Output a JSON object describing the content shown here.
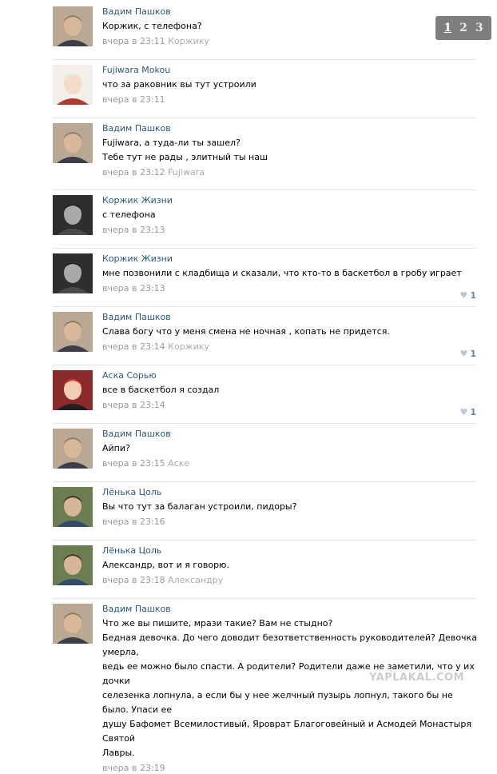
{
  "pager": {
    "pages": [
      "1",
      "2",
      "3"
    ],
    "current": "1"
  },
  "watermark": "YAPLAKAL.COM",
  "comments": [
    {
      "avatar": "putin",
      "author": "Вадим Пашков",
      "lines": [
        "Коржик, с телефона?"
      ],
      "time": "вчера в 23:11",
      "reply_to": "Коржику",
      "likes": ""
    },
    {
      "avatar": "anime-white",
      "author": "Fujiwara Mokou",
      "lines": [
        "что за раковник вы тут устроили"
      ],
      "time": "вчера в 23:11",
      "reply_to": "",
      "likes": ""
    },
    {
      "avatar": "putin",
      "author": "Вадим Пашков",
      "lines": [
        "Fujiwara, а туда-ли ты зашел?",
        "Тебе тут не рады , элитный ты наш"
      ],
      "time": "вчера в 23:12",
      "reply_to": "Fujiwara",
      "likes": ""
    },
    {
      "avatar": "bw-man",
      "author": "Коржик Жизни",
      "lines": [
        "с телефона"
      ],
      "time": "вчера в 23:13",
      "reply_to": "",
      "likes": ""
    },
    {
      "avatar": "bw-man",
      "author": "Коржик Жизни",
      "lines": [
        "мне позвонили с кладбища и сказали, что кто-то в баскетбол в гробу играет"
      ],
      "time": "вчера в 23:13",
      "reply_to": "",
      "likes": "1"
    },
    {
      "avatar": "putin",
      "author": "Вадим Пашков",
      "lines": [
        "Слава богу что у меня смена не ночная , копать не придется."
      ],
      "time": "вчера в 23:14",
      "reply_to": "Коржику",
      "likes": "1"
    },
    {
      "avatar": "anime-red",
      "author": "Аска Сорью",
      "lines": [
        "все в баскетбол я создал"
      ],
      "time": "вчера в 23:14",
      "reply_to": "",
      "likes": "1"
    },
    {
      "avatar": "putin",
      "author": "Вадим Пашков",
      "lines": [
        "Айпи?"
      ],
      "time": "вчера в 23:15",
      "reply_to": "Аске",
      "likes": ""
    },
    {
      "avatar": "young-man",
      "author": "Лёнька Цоль",
      "lines": [
        "Вы что тут за балаган устроили, пидоры?"
      ],
      "time": "вчера в 23:16",
      "reply_to": "",
      "likes": ""
    },
    {
      "avatar": "young-man",
      "author": "Лёнька Цоль",
      "lines": [
        "Александр, вот и я говорю."
      ],
      "time": "вчера в 23:18",
      "reply_to": "Александру",
      "likes": ""
    },
    {
      "avatar": "putin",
      "author": "Вадим Пашков",
      "lines": [
        "Что же вы пишите, мрази такие? Вам не стыдно?",
        "Бедная девочка. До чего доводит безответственность руководителей? Девочка умерла,",
        "ведь ее можно было спасти. А родители? Родители даже не заметили, что у их дочки",
        "селезенка лопнула, а если бы у нее желчный пузырь лопнул, такого бы не было. Упаси ее",
        "душу Бафомет Всемилостивый, Яроврат Благоговейный и Асмодей Монастыря Святой",
        "Лавры."
      ],
      "time": "вчера в 23:19",
      "reply_to": "",
      "likes": ""
    }
  ]
}
